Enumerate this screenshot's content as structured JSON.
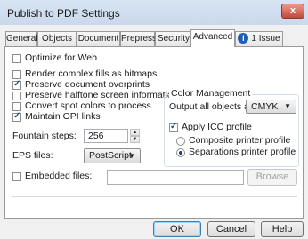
{
  "window": {
    "title": "Publish to PDF Settings",
    "close_glyph": "x"
  },
  "tabs": [
    {
      "label": "General"
    },
    {
      "label": "Objects"
    },
    {
      "label": "Document"
    },
    {
      "label": "Prepress"
    },
    {
      "label": "Security"
    },
    {
      "label": "Advanced",
      "active": true
    },
    {
      "label": "1 Issue",
      "icon": "info-icon",
      "icon_glyph": "i"
    }
  ],
  "advanced": {
    "optimize_for_web": {
      "label": "Optimize for Web",
      "checked": false
    },
    "render_complex_fills": {
      "label": "Render complex fills as bitmaps",
      "checked": false
    },
    "preserve_overprints": {
      "label": "Preserve document overprints",
      "checked": true
    },
    "preserve_halftone": {
      "label": "Preserve halftone screen information",
      "checked": false
    },
    "convert_spot_colors": {
      "label": "Convert spot colors to process",
      "checked": false
    },
    "maintain_opi_links": {
      "label": "Maintain OPI links",
      "checked": true
    },
    "fountain_steps": {
      "label": "Fountain steps:",
      "value": "256",
      "up_glyph": "▲",
      "down_glyph": "▼"
    },
    "eps_files": {
      "label": "EPS files:",
      "value": "PostScript",
      "arrow_glyph": "▼"
    },
    "embedded_files": {
      "label": "Embedded files:",
      "checked": false,
      "value": "",
      "browse_label": "Browse"
    }
  },
  "color_management": {
    "title": "Color Management",
    "output_label": "Output all objects as:",
    "output_value": "CMYK",
    "arrow_glyph": "▼",
    "apply_icc": {
      "label": "Apply ICC profile",
      "checked": true
    },
    "profile_options": [
      {
        "label": "Composite printer profile",
        "selected": false
      },
      {
        "label": "Separations printer profile",
        "selected": true
      }
    ]
  },
  "buttons": {
    "ok": "OK",
    "cancel": "Cancel",
    "help": "Help"
  },
  "colors": {
    "close_button": "#c4473a",
    "info_icon": "#1d5fb7",
    "active_tab": "#ffffff"
  }
}
